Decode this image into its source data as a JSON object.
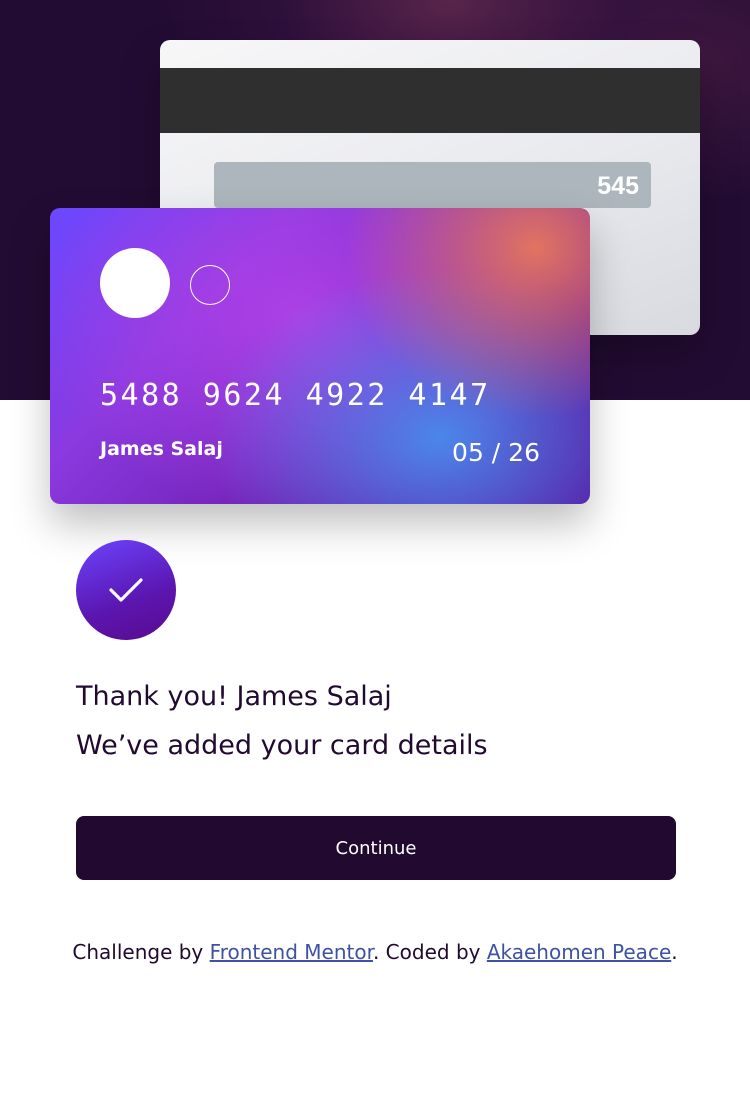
{
  "colors": {
    "dark_violet": "#21092f",
    "link": "#3e52a3",
    "gradient_start": "#6348fe",
    "gradient_end": "#610595"
  },
  "card_back": {
    "cvc": "545"
  },
  "card_front": {
    "number": "5488 9624 4922 4147",
    "holder_name": "James Salaj",
    "expiry": "05 / 26"
  },
  "success": {
    "icon": "check-icon",
    "thanks_text": "Thank you! James Salaj",
    "added_text": "We’ve added your card details",
    "continue_label": "Continue"
  },
  "attribution": {
    "challenge_prefix": "Challenge by ",
    "challenge_link": "Frontend Mentor",
    "coded_prefix": ". Coded by ",
    "author_link": "Akaehomen Peace",
    "suffix": "."
  }
}
